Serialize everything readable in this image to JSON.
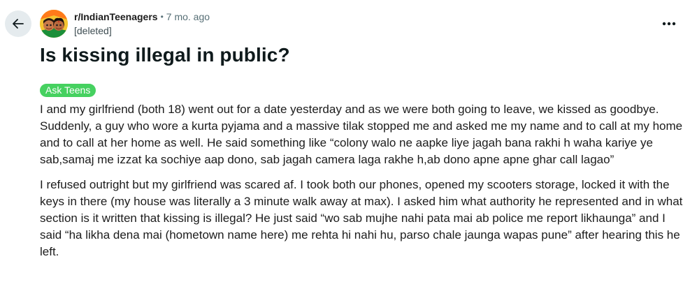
{
  "nav": {
    "back_icon": "arrow-left-icon",
    "more_icon": "ellipsis-horizontal-icon"
  },
  "post": {
    "subreddit": "r/IndianTeenagers",
    "separator": "•",
    "age": "7 mo. ago",
    "author": "[deleted]",
    "title": "Is kissing illegal in public?",
    "flair": {
      "label": "Ask Teens",
      "color": "#46d160"
    },
    "paragraphs": [
      "I and my girlfriend (both 18) went out for a date yesterday and as we were both going to leave, we kissed as goodbye. Suddenly, a guy who wore a kurta pyjama and a massive tilak stopped me and asked me my name and to call at my home and to call at her home as well. He said something like “colony walo ne aapke liye jagah bana rakhi h waha kariye ye sab,samaj me izzat ka sochiye aap dono, sab jagah camera laga rakhe h,ab dono apne apne ghar call lagao”",
      "I refused outright but my girlfriend was scared af. I took both our phones, opened my scooters storage, locked it with the keys in there (my house was literally a 3 minute walk away at max). I asked him what authority he represented and in what section is it written that kissing is illegal? He just said “wo sab mujhe nahi pata mai ab police me report likhaunga” and I said “ha likha dena mai (hometown name here) me rehta hi nahi hu, parso chale jaunga wapas pune” after hearing this he left."
    ]
  },
  "colors": {
    "back_button_bg": "#e5ebee",
    "meta_gray": "#576f76",
    "text": "#1c1c1c"
  }
}
